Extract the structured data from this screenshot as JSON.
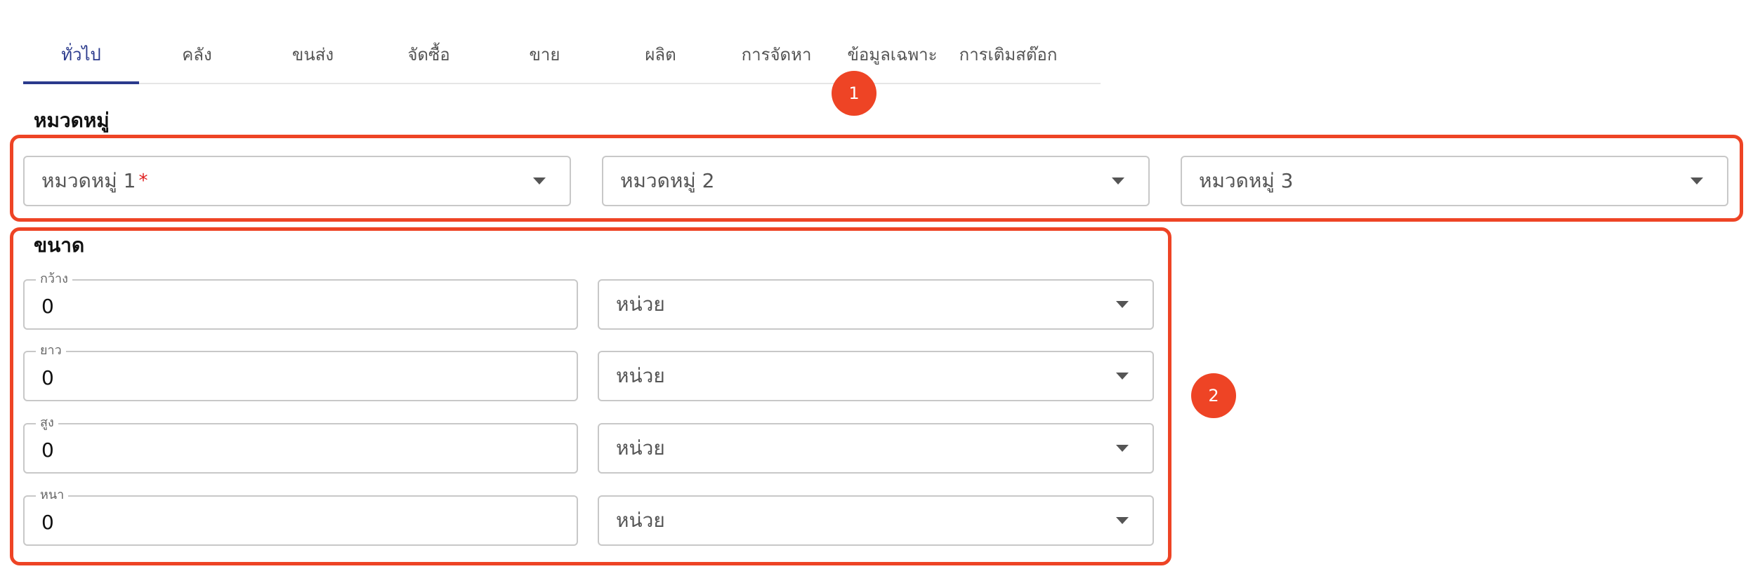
{
  "tabs": [
    {
      "label": "ทั่วไป",
      "active": true
    },
    {
      "label": "คลัง"
    },
    {
      "label": "ขนส่ง"
    },
    {
      "label": "จัดซื้อ"
    },
    {
      "label": "ขาย"
    },
    {
      "label": "ผลิต"
    },
    {
      "label": "การจัดหา"
    },
    {
      "label": "ข้อมูลเฉพาะ"
    },
    {
      "label": "การเติมสต๊อก"
    }
  ],
  "category": {
    "title": "หมวดหมู่",
    "fields": [
      {
        "label": "หมวดหมู่ 1",
        "required_mark": "*"
      },
      {
        "label": "หมวดหมู่ 2"
      },
      {
        "label": "หมวดหมู่ 3"
      }
    ]
  },
  "size": {
    "title": "ขนาด",
    "rows": [
      {
        "label": "กว้าง",
        "value": "0",
        "unit": "หน่วย"
      },
      {
        "label": "ยาว",
        "value": "0",
        "unit": "หน่วย"
      },
      {
        "label": "สูง",
        "value": "0",
        "unit": "หน่วย"
      },
      {
        "label": "หนา",
        "value": "0",
        "unit": "หน่วย"
      }
    ]
  },
  "markers": {
    "one": "1",
    "two": "2"
  },
  "colors": {
    "accent": "#2b3a8c",
    "highlight": "#ee4425",
    "required": "#e02020"
  },
  "icons": {
    "select_caret": "caret-down-icon"
  }
}
